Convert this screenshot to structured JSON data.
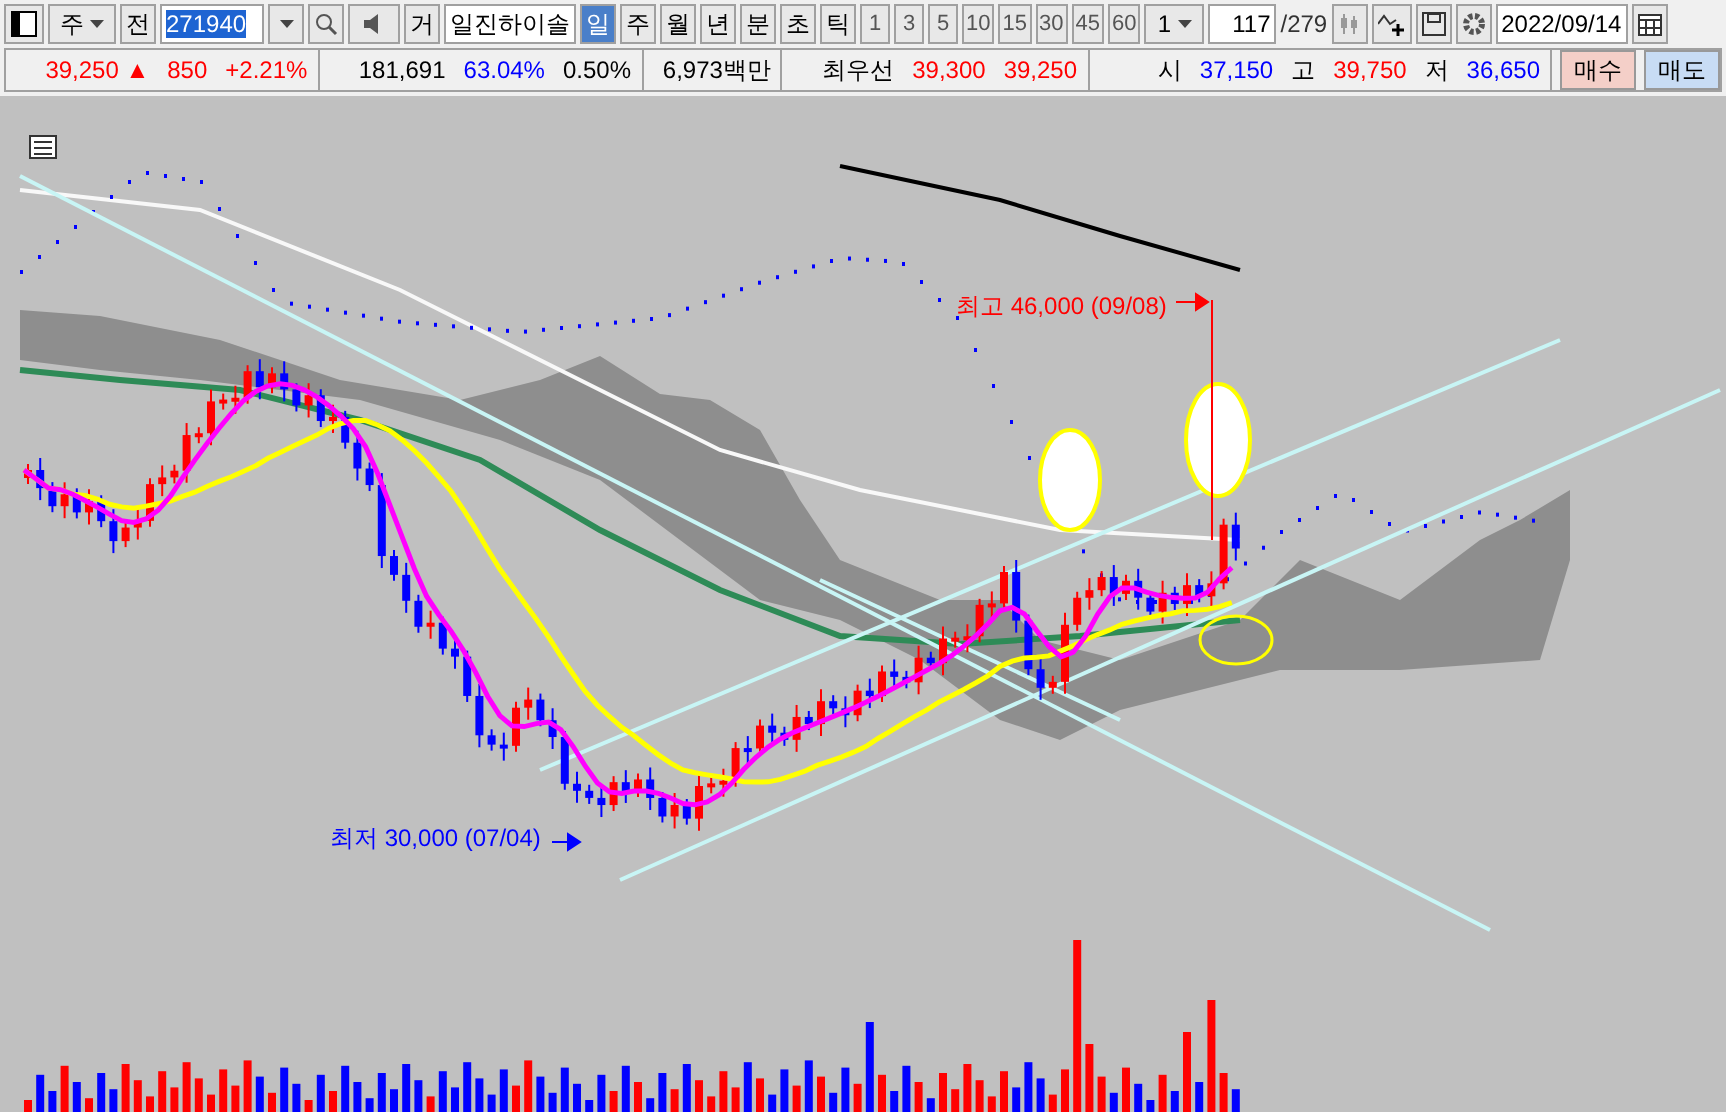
{
  "toolbar": {
    "market": "주",
    "prev_button": "전",
    "code": "271940",
    "type_button": "거",
    "stock_name": "일진하이솔",
    "periods": [
      {
        "label": "일",
        "selected": true
      },
      {
        "label": "주",
        "selected": false
      },
      {
        "label": "월",
        "selected": false
      },
      {
        "label": "년",
        "selected": false
      },
      {
        "label": "분",
        "selected": false
      },
      {
        "label": "초",
        "selected": false
      },
      {
        "label": "틱",
        "selected": false
      }
    ],
    "intervals": [
      {
        "label": "1",
        "selected": false
      },
      {
        "label": "3",
        "selected": false
      },
      {
        "label": "5",
        "selected": false
      },
      {
        "label": "10",
        "selected": false
      },
      {
        "label": "15",
        "selected": false
      },
      {
        "label": "30",
        "selected": false
      },
      {
        "label": "45",
        "selected": false
      },
      {
        "label": "60",
        "selected": false
      }
    ],
    "unit_select": "1",
    "count": "117",
    "total": "/279",
    "date": "2022/09/14"
  },
  "quote": {
    "segments": [
      [
        {
          "text": "39,250 ▲",
          "color": "#ff0000"
        },
        {
          "text": "850",
          "color": "#ff0000"
        },
        {
          "text": "+2.21%",
          "color": "#ff0000"
        }
      ],
      [
        {
          "text": "181,691",
          "color": "#000000"
        },
        {
          "text": "63.04%",
          "color": "#0000ff"
        },
        {
          "text": "0.50%",
          "color": "#000000"
        }
      ],
      [
        {
          "text": "6,973백만",
          "color": "#000000"
        }
      ],
      [
        {
          "text": "최우선",
          "color": "#000000"
        },
        {
          "text": "39,300",
          "color": "#ff0000"
        },
        {
          "text": "39,250",
          "color": "#ff0000"
        }
      ],
      [
        {
          "text": "시",
          "color": "#000000"
        },
        {
          "text": "37,150",
          "color": "#0000ff"
        },
        {
          "text": "고",
          "color": "#000000"
        },
        {
          "text": "39,750",
          "color": "#ff0000"
        },
        {
          "text": "저",
          "color": "#000000"
        },
        {
          "text": "36,650",
          "color": "#0000ff"
        }
      ]
    ],
    "buy_button": "매수",
    "sell_button": "매도"
  },
  "chart": {
    "high_label": "최고 46,000 (09/08)",
    "low_label": "최저 30,000 (07/04)"
  }
}
